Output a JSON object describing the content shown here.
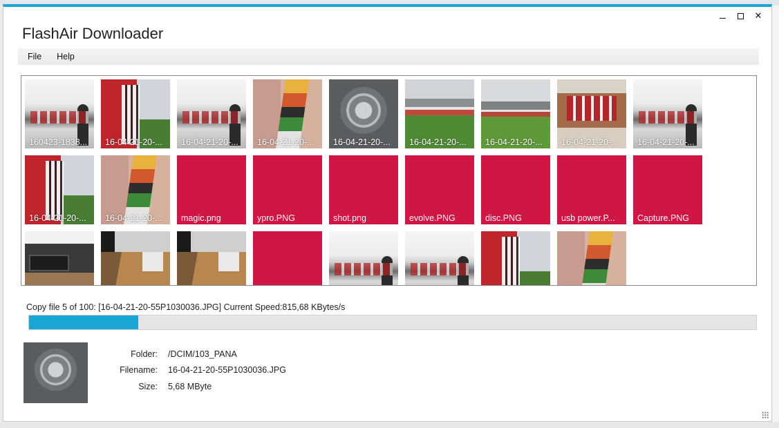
{
  "window": {
    "title": "FlashAir Downloader",
    "accent": "#1aa6d4",
    "controls": {
      "minimize_icon": "minimize-icon",
      "maximize_icon": "maximize-icon",
      "close_icon": "close-icon",
      "close_glyph": "✕"
    }
  },
  "menu": [
    {
      "label": "File"
    },
    {
      "label": "Help"
    }
  ],
  "placeholder_color": "#d01644",
  "thumbnails": [
    {
      "label": "160423-1838...",
      "kind": "photo",
      "art": "room"
    },
    {
      "label": "16-04-21-20-...",
      "kind": "photo",
      "art": "banner"
    },
    {
      "label": "16-04-21-20-...",
      "kind": "photo",
      "art": "room"
    },
    {
      "label": "16-04-21-20-...",
      "kind": "photo",
      "art": "graffiti"
    },
    {
      "label": "16-04-21-20-...",
      "kind": "photo",
      "art": "cover"
    },
    {
      "label": "16-04-21-20-...",
      "kind": "photo",
      "art": "stadium"
    },
    {
      "label": "16-04-21-20-...",
      "kind": "photo",
      "art": "stadium2"
    },
    {
      "label": "16-04-21-20-...",
      "kind": "photo",
      "art": "shirts"
    },
    {
      "label": "16-04-21-20-...",
      "kind": "photo",
      "art": "room"
    },
    {
      "label": "16-04-21-20-...",
      "kind": "photo",
      "art": "banner"
    },
    {
      "label": "16-04-21-20-...",
      "kind": "photo",
      "art": "graffiti"
    },
    {
      "label": "magic.png",
      "kind": "placeholder"
    },
    {
      "label": "ypro.PNG",
      "kind": "placeholder"
    },
    {
      "label": "shot.png",
      "kind": "placeholder"
    },
    {
      "label": "evolve.PNG",
      "kind": "placeholder"
    },
    {
      "label": "disc.PNG",
      "kind": "placeholder"
    },
    {
      "label": "usb power.P...",
      "kind": "placeholder"
    },
    {
      "label": "Capture.PNG",
      "kind": "placeholder"
    },
    {
      "label": "",
      "kind": "photo",
      "art": "living"
    },
    {
      "label": "",
      "kind": "photo",
      "art": "wood"
    },
    {
      "label": "",
      "kind": "photo",
      "art": "wood"
    },
    {
      "label": "",
      "kind": "placeholder"
    },
    {
      "label": "",
      "kind": "photo",
      "art": "room"
    },
    {
      "label": "",
      "kind": "photo",
      "art": "room"
    },
    {
      "label": "",
      "kind": "photo",
      "art": "banner"
    },
    {
      "label": "",
      "kind": "photo",
      "art": "graffiti"
    }
  ],
  "status": {
    "text": "Copy file 5 of 100: [16-04-21-20-55P1030036.JPG] Current Speed:815,68 KBytes/s",
    "progress_percent": 15
  },
  "details": {
    "preview_art": "cover",
    "folder_label": "Folder:",
    "folder": "/DCIM/103_PANA",
    "filename_label": "Filename:",
    "filename": "16-04-21-20-55P1030036.JPG",
    "size_label": "Size:",
    "size": "5,68 MByte"
  }
}
